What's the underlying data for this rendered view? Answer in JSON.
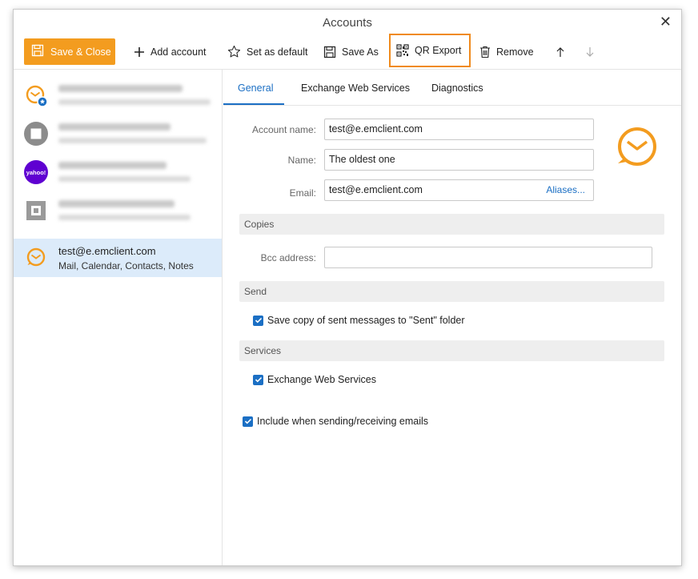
{
  "window": {
    "title": "Accounts"
  },
  "toolbar": {
    "save_close": "Save & Close",
    "add_account": "Add account",
    "set_default": "Set as default",
    "save_as": "Save As",
    "qr_export": "QR Export",
    "remove": "Remove"
  },
  "accounts": [
    {
      "line1": "",
      "line2": "",
      "avatar": "emclient-icon",
      "blurred": true
    },
    {
      "line1": "",
      "line2": "",
      "avatar": "gray-square-icon",
      "blurred": true
    },
    {
      "line1": "",
      "line2": "",
      "avatar": "yahoo-icon",
      "avatar_text": "yahoo!",
      "blurred": true
    },
    {
      "line1": "",
      "line2": "",
      "avatar": "square-outline-icon",
      "blurred": true
    },
    {
      "line1": "test@e.emclient.com",
      "line2": "Mail, Calendar, Contacts, Notes",
      "avatar": "emclient-icon",
      "selected": true
    }
  ],
  "tabs": [
    {
      "label": "General",
      "active": true
    },
    {
      "label": "Exchange Web Services"
    },
    {
      "label": "Diagnostics"
    }
  ],
  "form": {
    "account_name_label": "Account name:",
    "account_name_value": "test@e.emclient.com",
    "name_label": "Name:",
    "name_value": "The oldest one",
    "email_label": "Email:",
    "email_value": "test@e.emclient.com",
    "aliases_link": "Aliases...",
    "bcc_label": "Bcc address:",
    "bcc_value": ""
  },
  "sections": {
    "copies": "Copies",
    "send": "Send",
    "services": "Services"
  },
  "checkboxes": {
    "save_sent": "Save copy of sent messages to \"Sent\" folder",
    "ews": "Exchange Web Services",
    "include_sync": "Include when sending/receiving emails"
  },
  "colors": {
    "accent_orange": "#f39c1f",
    "accent_blue": "#1b6fc4",
    "selection": "#dcebfa",
    "yahoo_purple": "#5f01d1"
  }
}
